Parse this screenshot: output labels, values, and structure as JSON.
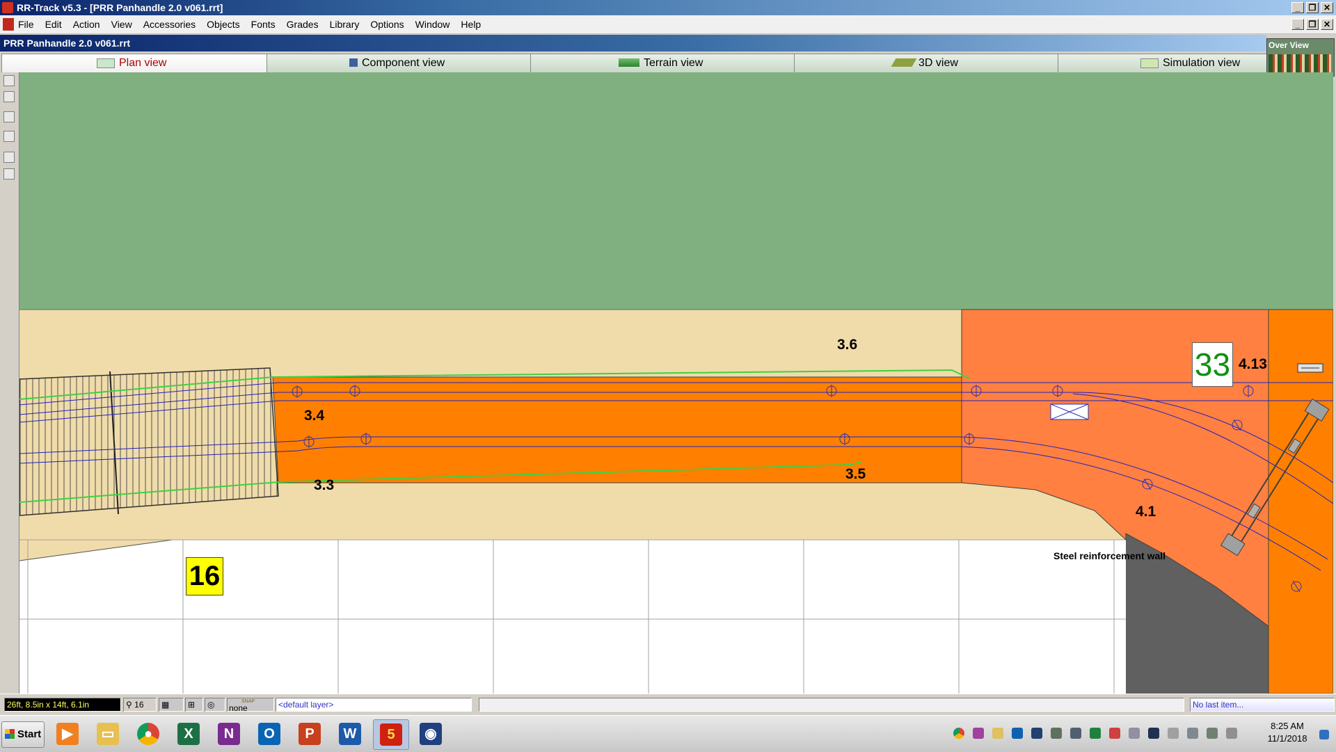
{
  "window": {
    "title": "RR-Track v5.3 - [PRR Panhandle 2.0 v061.rrt]",
    "controls": [
      "_",
      "❐",
      "✕"
    ]
  },
  "menubar": {
    "items": [
      "File",
      "Edit",
      "Action",
      "View",
      "Accessories",
      "Objects",
      "Fonts",
      "Grades",
      "Library",
      "Options",
      "Window",
      "Help"
    ]
  },
  "document": {
    "title": "PRR Panhandle 2.0 v061.rrt"
  },
  "tabs": [
    {
      "label": "Plan view",
      "active": true
    },
    {
      "label": "Component view",
      "active": false
    },
    {
      "label": "Terrain view",
      "active": false
    },
    {
      "label": "3D view",
      "active": false
    },
    {
      "label": "Simulation view",
      "active": false
    }
  ],
  "overview": {
    "label": "Over View"
  },
  "canvas": {
    "track_labels": [
      "3.6",
      "3.4",
      "3.3",
      "3.5",
      "4.13",
      "4.1"
    ],
    "section_numbers": [
      "33",
      "16"
    ],
    "annotation": "Steel reinforcement wall",
    "colors": {
      "grass": "#80b080",
      "benchwork": "#f0dcaa",
      "roadbed_orange": "#ff8000",
      "roadbed_salmon": "#ff8040",
      "wall_gray": "#606060",
      "track_blue": "#2020c0",
      "grade_green": "#40d040"
    }
  },
  "statusbar": {
    "dimensions": "26ft, 8.5in x 14ft, 6.1in",
    "zoom": "16",
    "snap_label": "SNAP",
    "snap_value": "none",
    "layer": "<default layer>",
    "last_item": "No last item..."
  },
  "taskbar": {
    "start_label": "Start",
    "time": "8:25 AM",
    "date": "11/1/2018"
  }
}
